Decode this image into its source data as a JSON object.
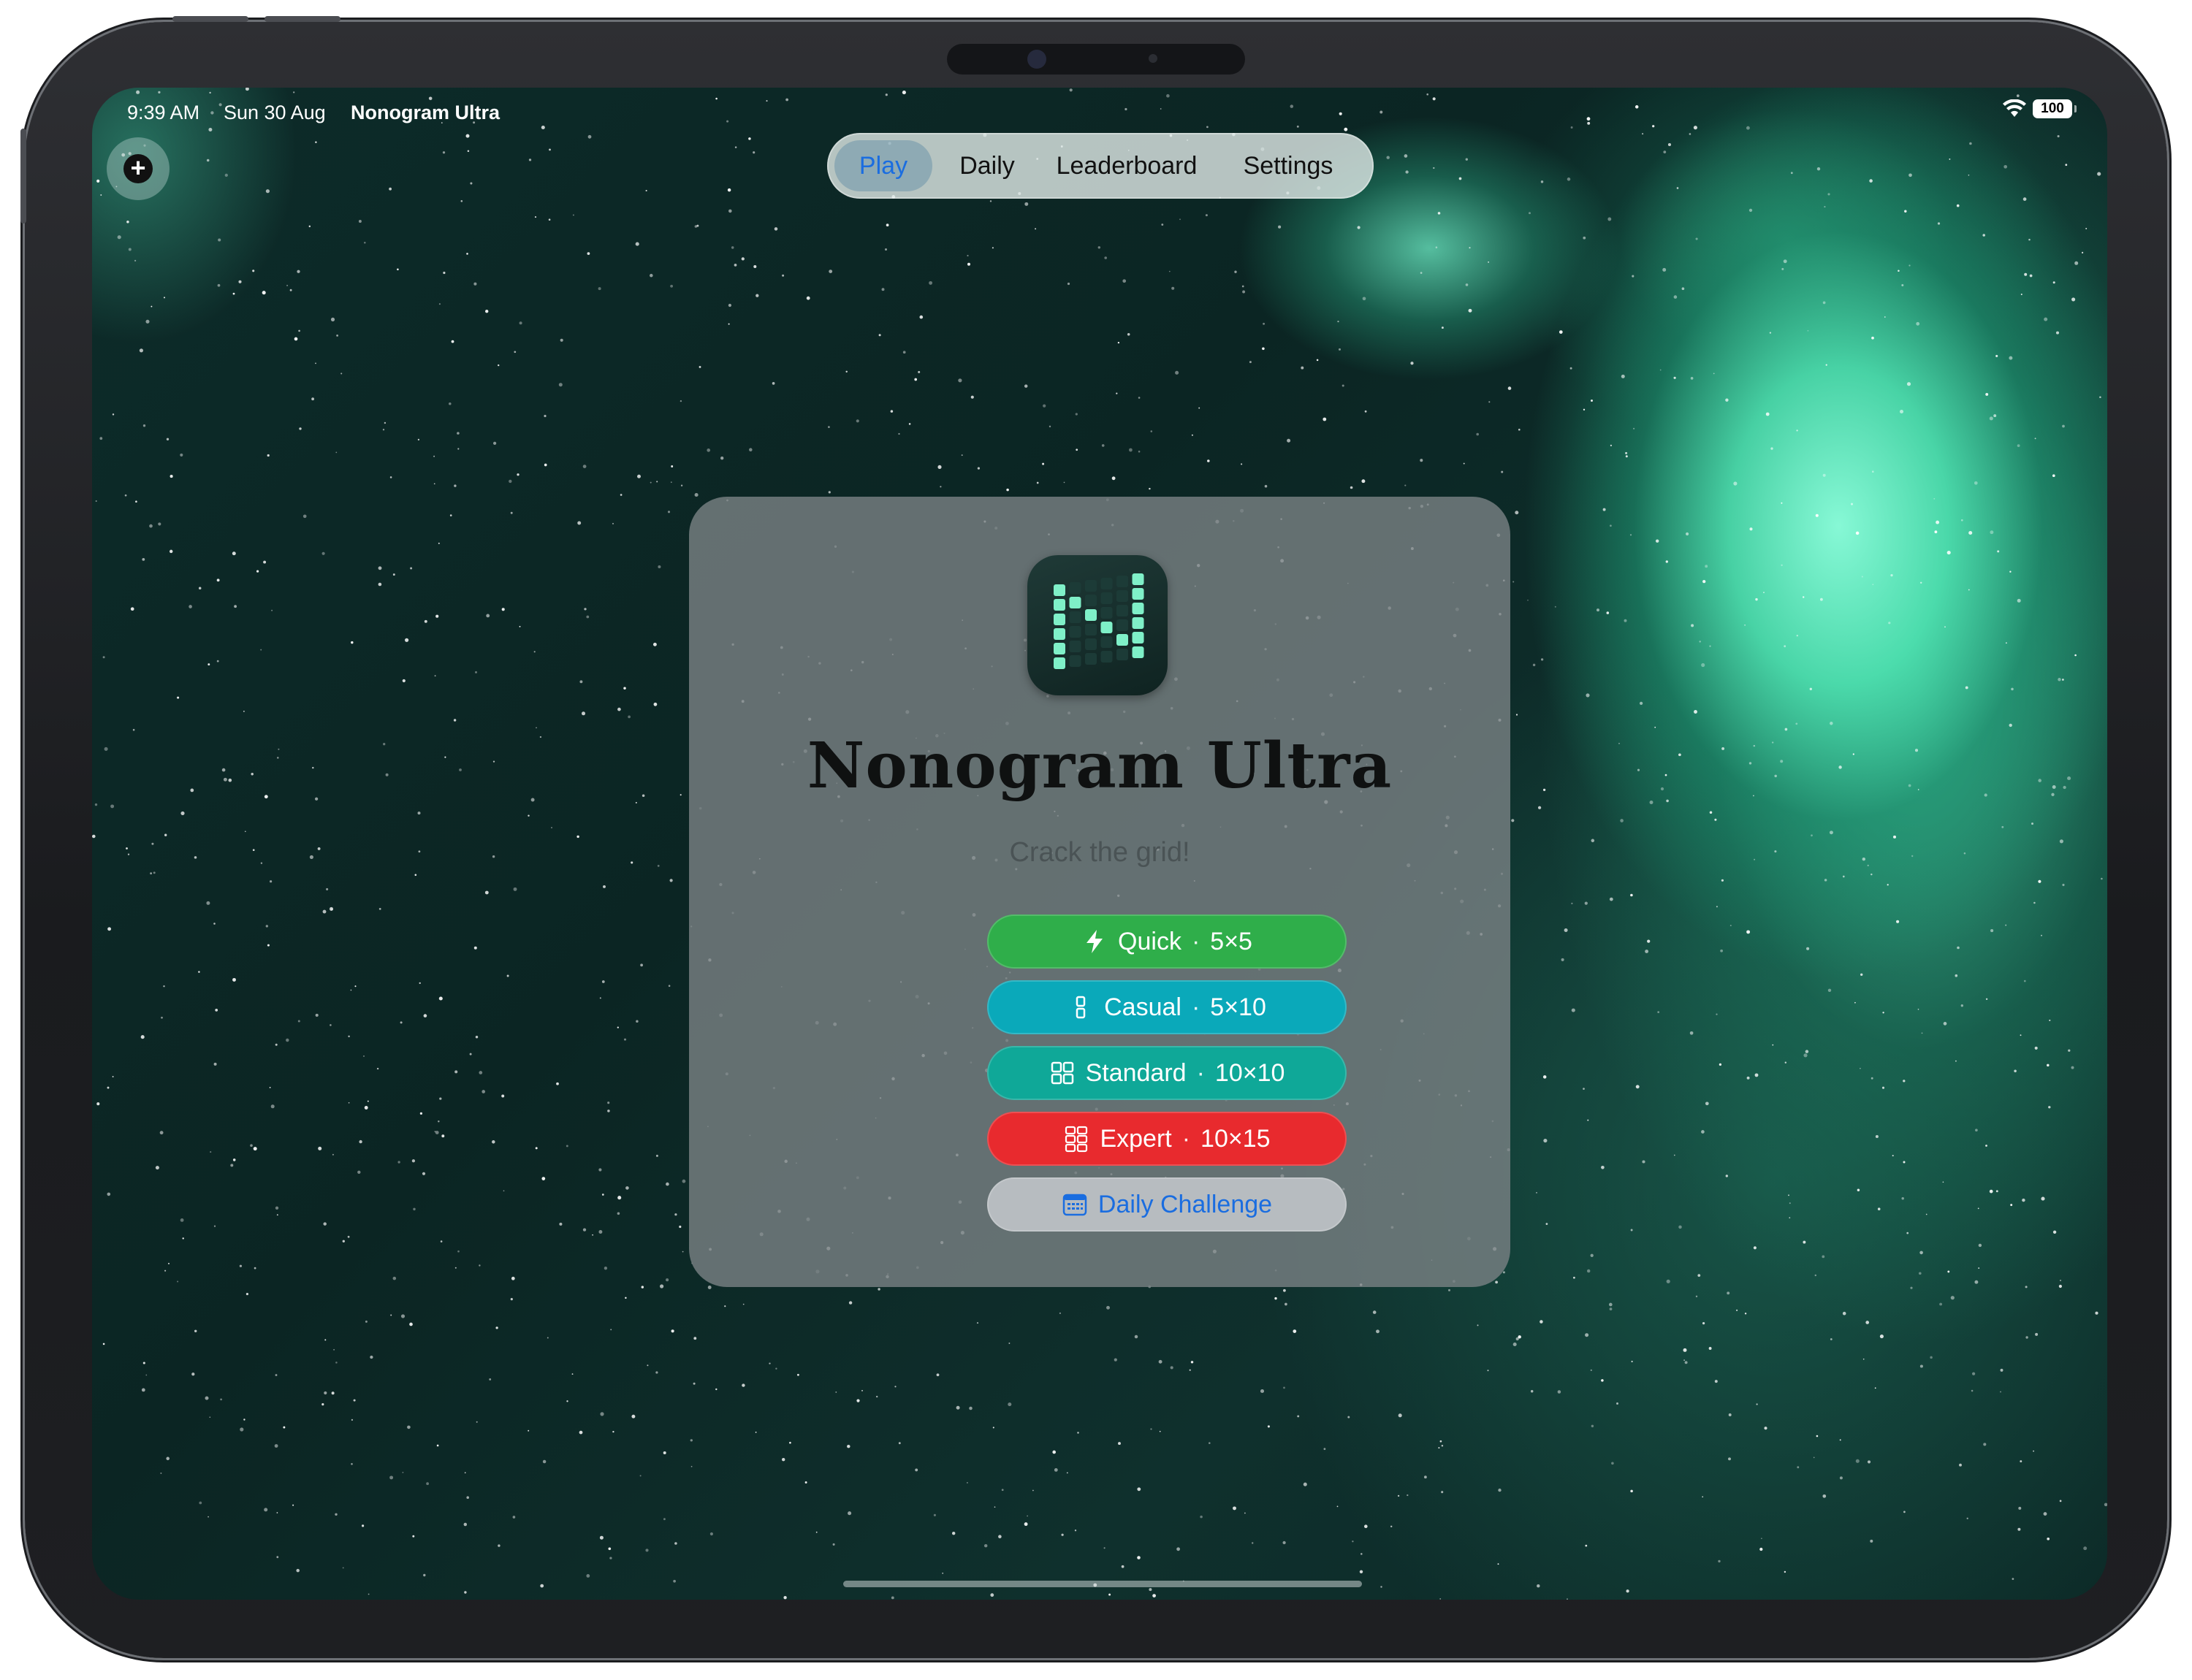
{
  "status_bar": {
    "time": "9:39 AM",
    "date": "Sun 30 Aug",
    "app_name": "Nonogram Ultra",
    "battery": "100",
    "wifi_icon": "wifi-icon"
  },
  "toolbar": {
    "add_icon": "plus-circle-icon"
  },
  "tabs": [
    {
      "label": "Play",
      "active": true
    },
    {
      "label": "Daily",
      "active": false
    },
    {
      "label": "Leaderboard",
      "active": false
    },
    {
      "label": "Settings",
      "active": false
    }
  ],
  "card": {
    "app_icon": "nonogram-n-icon",
    "title": "Nonogram Ultra",
    "subtitle": "Crack the grid!",
    "modes": [
      {
        "icon": "bolt-icon",
        "label": "Quick",
        "size": "5×5",
        "color": "#2fae4a",
        "text_color": "#ffffff"
      },
      {
        "icon": "tall-grid-icon",
        "label": "Casual",
        "size": "5×10",
        "color": "#0aa9ba",
        "text_color": "#ffffff"
      },
      {
        "icon": "grid-2x2-icon",
        "label": "Standard",
        "size": "10×10",
        "color": "#0fa898",
        "text_color": "#ffffff"
      },
      {
        "icon": "grid-2x3-icon",
        "label": "Expert",
        "size": "10×15",
        "color": "#e82a2e",
        "text_color": "#ffffff"
      }
    ],
    "daily_challenge": {
      "icon": "calendar-icon",
      "label": "Daily Challenge",
      "color": "#b7bcc0",
      "text_color": "#1a6de0"
    }
  }
}
